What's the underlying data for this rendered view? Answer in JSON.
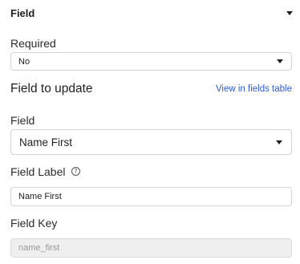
{
  "section": {
    "title": "Field",
    "collapse_icon": "caret-down-icon"
  },
  "required": {
    "label": "Required",
    "value": "No"
  },
  "field_to_update": {
    "heading": "Field to update",
    "link": "View in fields table"
  },
  "field": {
    "label": "Field",
    "value": "Name First"
  },
  "field_label": {
    "label": "Field Label",
    "help_icon": "question-circle-icon",
    "help_glyph": "?",
    "value": "Name First"
  },
  "field_key": {
    "label": "Field Key",
    "value": "name_first"
  },
  "colors": {
    "link": "#2f5bd8",
    "border": "#d4d4d4",
    "disabled_bg": "#efefef"
  }
}
